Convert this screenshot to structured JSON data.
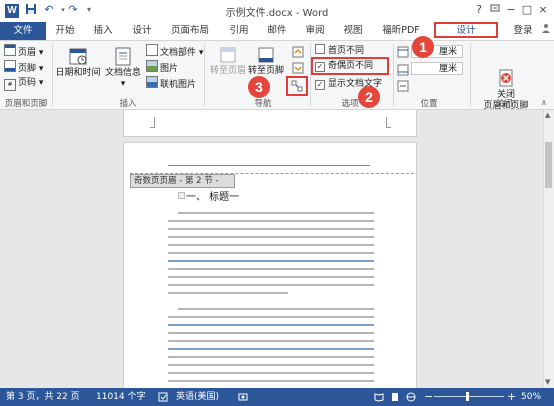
{
  "window": {
    "title": "示例文件.docx - Word",
    "help": "?",
    "restore_icon": "restore-icon",
    "minimize": "−",
    "maximize": "□",
    "close": "×"
  },
  "tabs": [
    "文件",
    "开始",
    "插入",
    "设计",
    "页面布局",
    "引用",
    "邮件",
    "审阅",
    "视图",
    "福昕PDF",
    "设计",
    "登录"
  ],
  "ribbon": {
    "header_footer": {
      "header": "页眉",
      "footer": "页脚",
      "page_number": "页码",
      "label": "页眉和页脚"
    },
    "insert": {
      "date_time": "日期和时间",
      "doc_info": "文档信息",
      "doc_parts": "文档部件",
      "picture": "图片",
      "online_picture": "联机图片",
      "label": "插入"
    },
    "navigation": {
      "goto_header": "转至页眉",
      "goto_footer": "转至页脚",
      "label": "导航"
    },
    "options": {
      "first_page_different": "首页不同",
      "odd_even_different": "奇偶页不同",
      "show_doc_text": "显示文档文字",
      "label": "选项"
    },
    "position": {
      "top_value": "厘米",
      "bottom_value": "厘米",
      "label": "位置"
    },
    "close": {
      "button": "关闭\n页眉和页脚",
      "label": "关闭"
    }
  },
  "callouts": [
    "1",
    "2",
    "3"
  ],
  "document": {
    "header_tag": "奇数页页眉 - 第 2 节 -",
    "heading": "一、 标题一"
  },
  "status": {
    "page": "第 3 页，共 22 页",
    "words": "11014 个字",
    "language": "英语(美国)",
    "zoom": "50%",
    "zoom_minus": "−",
    "zoom_plus": "+"
  },
  "colors": {
    "accent": "#2b579a",
    "callout": "#e5463c"
  }
}
